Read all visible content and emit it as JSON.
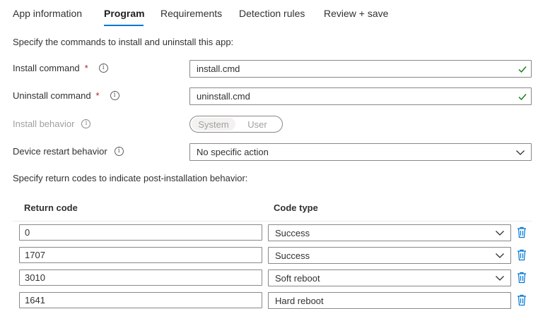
{
  "tabs": [
    {
      "label": "App information"
    },
    {
      "label": "Program"
    },
    {
      "label": "Requirements"
    },
    {
      "label": "Detection rules"
    },
    {
      "label": "Review + save"
    }
  ],
  "intro_text": "Specify the commands to install and uninstall this app:",
  "install_command": {
    "label": "Install command",
    "required_mark": "*",
    "value": "install.cmd"
  },
  "uninstall_command": {
    "label": "Uninstall command",
    "required_mark": "*",
    "value": "uninstall.cmd"
  },
  "install_behavior": {
    "label": "Install behavior",
    "options": [
      "System",
      "User"
    ],
    "selected": "System"
  },
  "restart_behavior": {
    "label": "Device restart behavior",
    "value": "No specific action"
  },
  "return_codes_text": "Specify return codes to indicate post-installation behavior:",
  "return_codes": {
    "col_code": "Return code",
    "col_type": "Code type",
    "rows": [
      {
        "code": "0",
        "type": "Success"
      },
      {
        "code": "1707",
        "type": "Success"
      },
      {
        "code": "3010",
        "type": "Soft reboot"
      },
      {
        "code": "1641",
        "type": "Hard reboot"
      }
    ]
  },
  "colors": {
    "accent": "#0078d4",
    "valid_check": "#107c10",
    "delete_icon": "#0078d4",
    "required": "#a4262c"
  }
}
